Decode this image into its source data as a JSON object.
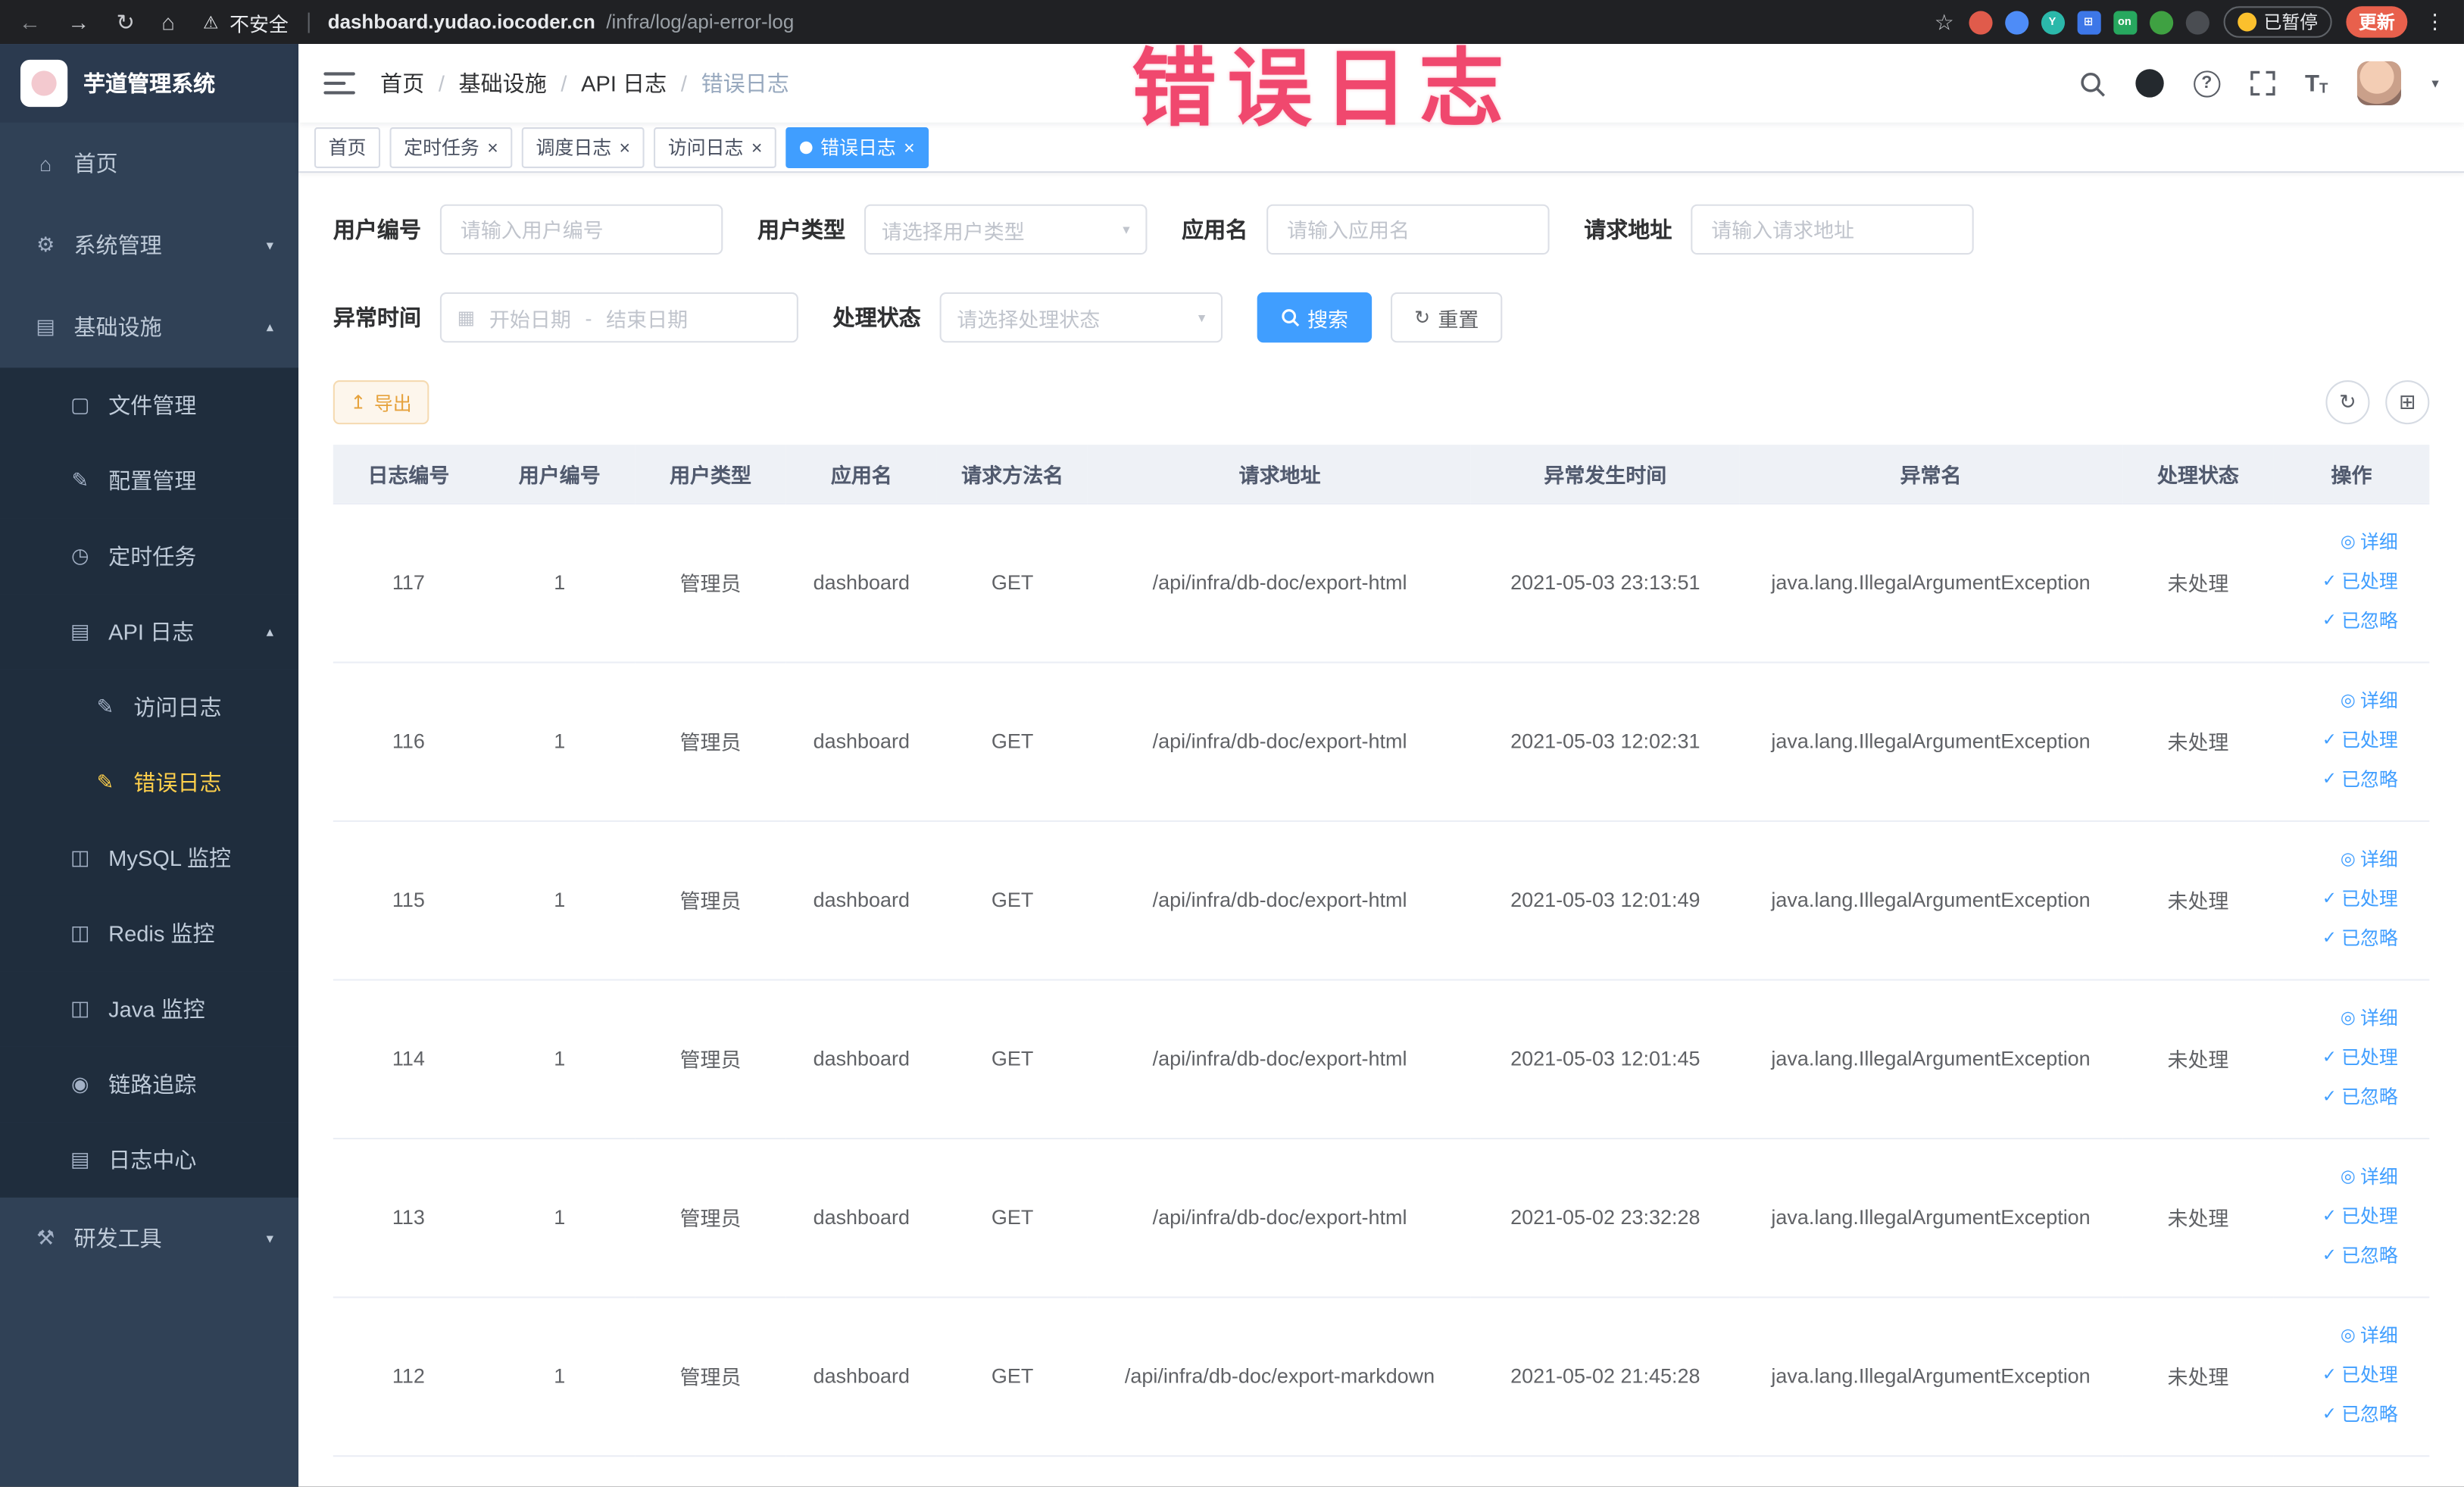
{
  "colors": {
    "accent": "#409EFF",
    "annotation": "#f0486e",
    "warning_button_text": "#e6a23c",
    "sidebar_bg": "#304156",
    "sidebar_submenu_bg": "#1f2d3d",
    "active_menu_text": "#ffd04b",
    "table_header_bg": "#eef1f6"
  },
  "glyphs": {
    "back": "←",
    "forward": "→",
    "reload": "↻",
    "home": "⌂",
    "warning": "⚠",
    "star": "☆",
    "more": "⋮",
    "caret_down": "▾",
    "caret_up": "▴",
    "close": "×",
    "question": "?",
    "t_large": "T",
    "t_small": "T",
    "calendar": "▦",
    "refresh": "↻",
    "export": "↥",
    "view": "◎",
    "check": "✓",
    "grid": "⊞",
    "select_arrow": "▾"
  },
  "annotation": {
    "text": "错误日志"
  },
  "browser": {
    "security_label": "不安全",
    "url_domain": "dashboard.yudao.iocoder.cn",
    "url_path": "/infra/log/api-error-log",
    "paused_chip": "已暂停",
    "update_button": "更新",
    "extensions": [
      {
        "name": "extension-icon-red",
        "color": "#e05b4b",
        "label": "",
        "shape": "circle"
      },
      {
        "name": "extension-icon-blue",
        "color": "#4e8cf7",
        "label": "",
        "shape": "circle"
      },
      {
        "name": "extension-icon-teal",
        "color": "#2bb8aa",
        "label": "Y",
        "shape": "circle"
      },
      {
        "name": "extension-icon-grid",
        "color": "#3d77e8",
        "label": "⊞",
        "shape": "square"
      },
      {
        "name": "extension-icon-on",
        "color": "#27a85f",
        "label": "on",
        "shape": "square"
      },
      {
        "name": "extension-icon-leaf",
        "color": "#3fa142",
        "label": "",
        "shape": "circle"
      },
      {
        "name": "extension-icon-dark",
        "color": "#4a4d52",
        "label": "",
        "shape": "circle"
      }
    ]
  },
  "sidebar": {
    "logo_title": "芋道管理系统",
    "items": [
      {
        "key": "home",
        "label": "首页",
        "glyph": "⌂",
        "icon": "home-icon",
        "level": 1
      },
      {
        "key": "system",
        "label": "系统管理",
        "glyph": "⚙",
        "icon": "gear-icon",
        "level": 1,
        "arrow": "down"
      },
      {
        "key": "infra",
        "label": "基础设施",
        "glyph": "▤",
        "icon": "infra-icon",
        "level": 1,
        "arrow": "up"
      },
      {
        "key": "file",
        "label": "文件管理",
        "glyph": "▢",
        "icon": "file-icon",
        "level": 2,
        "sub": true
      },
      {
        "key": "config",
        "label": "配置管理",
        "glyph": "✎",
        "icon": "config-icon",
        "level": 2,
        "sub": true
      },
      {
        "key": "job",
        "label": "定时任务",
        "glyph": "◷",
        "icon": "clock-icon",
        "level": 2,
        "sub": true
      },
      {
        "key": "api-log",
        "label": "API 日志",
        "glyph": "▤",
        "icon": "api-log-icon",
        "level": 2,
        "sub": true,
        "arrow": "up"
      },
      {
        "key": "access-log",
        "label": "访问日志",
        "glyph": "✎",
        "icon": "access-log-icon",
        "level": 3,
        "sub": true
      },
      {
        "key": "error-log",
        "label": "错误日志",
        "glyph": "✎",
        "icon": "error-log-icon",
        "level": 3,
        "sub": true,
        "active": true
      },
      {
        "key": "mysql",
        "label": "MySQL 监控",
        "glyph": "◫",
        "icon": "mysql-icon",
        "level": 2,
        "sub": true
      },
      {
        "key": "redis",
        "label": "Redis 监控",
        "glyph": "◫",
        "icon": "redis-icon",
        "level": 2,
        "sub": true
      },
      {
        "key": "java",
        "label": "Java 监控",
        "glyph": "◫",
        "icon": "java-icon",
        "level": 2,
        "sub": true
      },
      {
        "key": "trace",
        "label": "链路追踪",
        "glyph": "◉",
        "icon": "trace-icon",
        "level": 2,
        "sub": true
      },
      {
        "key": "log-center",
        "label": "日志中心",
        "glyph": "▤",
        "icon": "log-center-icon",
        "level": 2,
        "sub": true
      },
      {
        "key": "devtools",
        "label": "研发工具",
        "glyph": "⚒",
        "icon": "tools-icon",
        "level": 1,
        "arrow": "down"
      }
    ]
  },
  "header": {
    "breadcrumb": [
      "首页",
      "基础设施",
      "API 日志",
      "错误日志"
    ]
  },
  "tabs": [
    {
      "key": "home",
      "label": "首页",
      "closable": false
    },
    {
      "key": "job",
      "label": "定时任务",
      "closable": true
    },
    {
      "key": "job-log",
      "label": "调度日志",
      "closable": true
    },
    {
      "key": "access-log",
      "label": "访问日志",
      "closable": true
    },
    {
      "key": "error-log",
      "label": "错误日志",
      "closable": true,
      "active": true
    }
  ],
  "filters": {
    "user_id": {
      "label": "用户编号",
      "placeholder": "请输入用户编号"
    },
    "user_type": {
      "label": "用户类型",
      "placeholder": "请选择用户类型"
    },
    "app_name": {
      "label": "应用名",
      "placeholder": "请输入应用名"
    },
    "request_url": {
      "label": "请求地址",
      "placeholder": "请输入请求地址"
    },
    "exception_time": {
      "label": "异常时间",
      "start_placeholder": "开始日期",
      "separator": "-",
      "end_placeholder": "结束日期"
    },
    "process_status": {
      "label": "处理状态",
      "placeholder": "请选择处理状态"
    },
    "search_button": "搜索",
    "reset_button": "重置"
  },
  "toolbar": {
    "export_button": "导出"
  },
  "table": {
    "columns": [
      "日志编号",
      "用户编号",
      "用户类型",
      "应用名",
      "请求方法名",
      "请求地址",
      "异常发生时间",
      "异常名",
      "处理状态",
      "操作"
    ],
    "field_order": [
      "id",
      "user_id",
      "user_type",
      "app",
      "method",
      "url",
      "time",
      "exception",
      "status"
    ],
    "rows": [
      {
        "id": "117",
        "user_id": "1",
        "user_type": "管理员",
        "app": "dashboard",
        "method": "GET",
        "url": "/api/infra/db-doc/export-html",
        "time": "2021-05-03 23:13:51",
        "exception": "java.lang.IllegalArgumentException",
        "status": "未处理"
      },
      {
        "id": "116",
        "user_id": "1",
        "user_type": "管理员",
        "app": "dashboard",
        "method": "GET",
        "url": "/api/infra/db-doc/export-html",
        "time": "2021-05-03 12:02:31",
        "exception": "java.lang.IllegalArgumentException",
        "status": "未处理"
      },
      {
        "id": "115",
        "user_id": "1",
        "user_type": "管理员",
        "app": "dashboard",
        "method": "GET",
        "url": "/api/infra/db-doc/export-html",
        "time": "2021-05-03 12:01:49",
        "exception": "java.lang.IllegalArgumentException",
        "status": "未处理"
      },
      {
        "id": "114",
        "user_id": "1",
        "user_type": "管理员",
        "app": "dashboard",
        "method": "GET",
        "url": "/api/infra/db-doc/export-html",
        "time": "2021-05-03 12:01:45",
        "exception": "java.lang.IllegalArgumentException",
        "status": "未处理"
      },
      {
        "id": "113",
        "user_id": "1",
        "user_type": "管理员",
        "app": "dashboard",
        "method": "GET",
        "url": "/api/infra/db-doc/export-html",
        "time": "2021-05-02 23:32:28",
        "exception": "java.lang.IllegalArgumentException",
        "status": "未处理"
      },
      {
        "id": "112",
        "user_id": "1",
        "user_type": "管理员",
        "app": "dashboard",
        "method": "GET",
        "url": "/api/infra/db-doc/export-markdown",
        "time": "2021-05-02 21:45:28",
        "exception": "java.lang.IllegalArgumentException",
        "status": "未处理"
      }
    ],
    "row_actions": [
      {
        "name": "detail-link",
        "label": "详细",
        "icon": "view"
      },
      {
        "name": "processed-link",
        "label": "已处理",
        "icon": "check"
      },
      {
        "name": "ignored-link",
        "label": "已忽略",
        "icon": "check"
      }
    ]
  }
}
